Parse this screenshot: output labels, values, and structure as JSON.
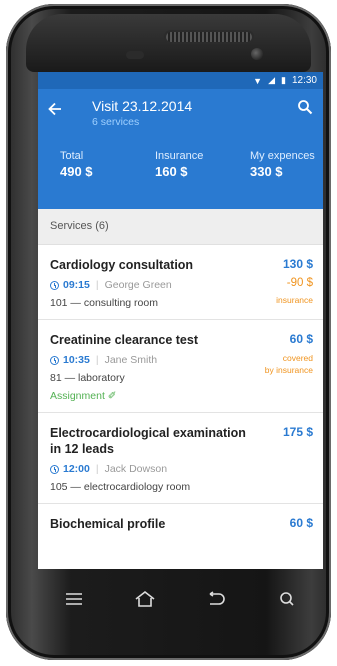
{
  "status": {
    "time": "12:30"
  },
  "header": {
    "title": "Visit 23.12.2014",
    "subtitle": "6 services",
    "back_icon": "arrow-left-icon",
    "search_icon": "search-icon"
  },
  "totals": [
    {
      "label": "Total",
      "value": "490 $"
    },
    {
      "label": "Insurance",
      "value": "160 $"
    },
    {
      "label": "My expences",
      "value": "330 $"
    }
  ],
  "section_label": "Services (6)",
  "services": [
    {
      "name": "Cardiology consultation",
      "price": "130 $",
      "time": "09:15",
      "doctor": "George Green",
      "room": "101 — consulting room",
      "insurance_amount": "-90 $",
      "insurance_label": "insurance"
    },
    {
      "name": "Creatinine clearance test",
      "price": "60 $",
      "time": "10:35",
      "doctor": "Jane Smith",
      "room": "81 — laboratory",
      "covered_line1": "covered",
      "covered_line2": "by insurance",
      "assignment": "Assignment"
    },
    {
      "name": "Electrocardiological examination in 12 leads",
      "price": "175 $",
      "time": "12:00",
      "doctor": "Jack Dowson",
      "room": "105 — electrocardiology room"
    },
    {
      "name": "Biochemical profile",
      "price": "60 $"
    }
  ],
  "colors": {
    "primary": "#2a7ad1",
    "statusbar": "#1f68b8",
    "warning": "#f0941f",
    "success": "#53b153"
  }
}
